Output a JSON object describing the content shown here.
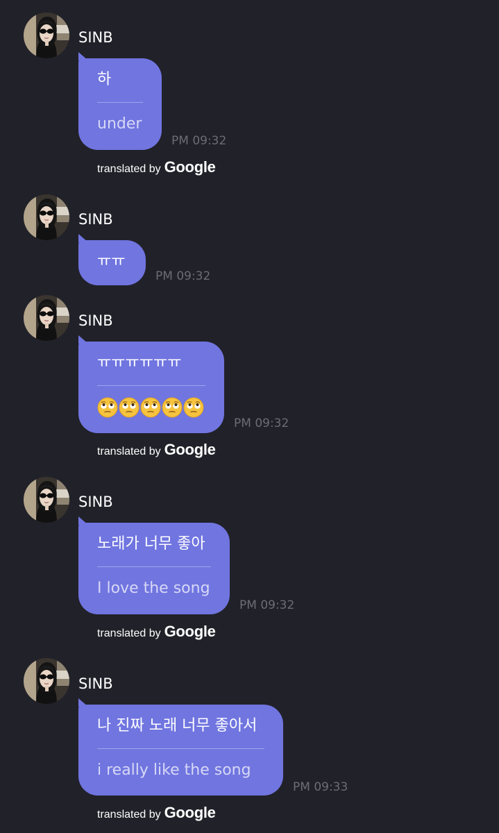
{
  "sender_name": "SINB",
  "translated_by": "translated by",
  "brand": "Google",
  "messages": [
    {
      "original": "하",
      "translation": "under",
      "time": "PM 09:32",
      "translated": true
    },
    {
      "original": "ㅠㅠ",
      "translation": "",
      "time": "PM 09:32",
      "translated": false
    },
    {
      "original": "ㅠㅠㅠㅠㅠㅠ",
      "translation": "🙄🙄🙄🙄🙄",
      "time": "PM 09:32",
      "translated": true,
      "translation_icon": "face-with-rolling-eyes-icon",
      "translation_icon_count": 5
    },
    {
      "original": "노래가 너무 좋아",
      "translation": "I love the song",
      "time": "PM 09:32",
      "translated": true
    },
    {
      "original": "나 진짜 노래 너무 좋아서",
      "translation": "i really like the song",
      "time": "PM 09:33",
      "translated": true
    }
  ],
  "colors": {
    "background": "#212129",
    "bubble": "#7075e0",
    "translation_text": "#d7d8f6",
    "timestamp": "#6c6c74"
  }
}
